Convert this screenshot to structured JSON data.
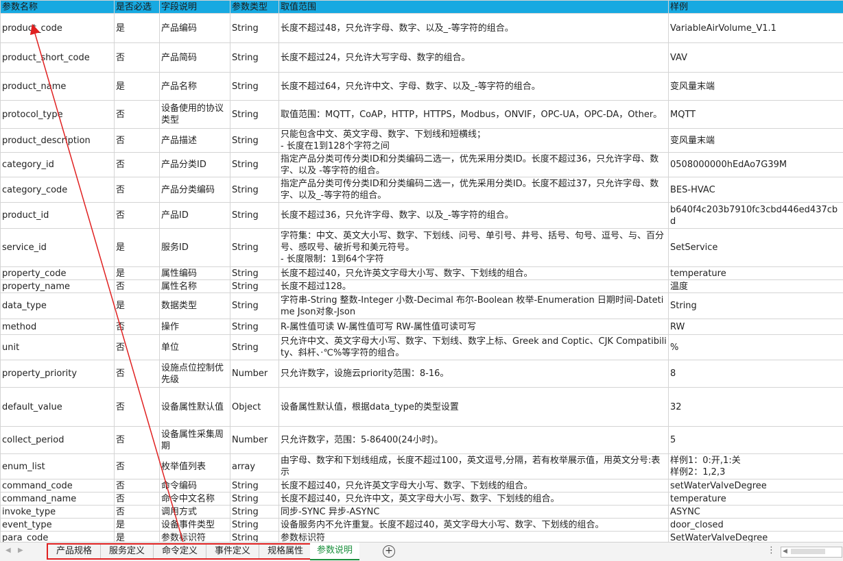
{
  "header": [
    "参数名称",
    "是否必选",
    "字段说明",
    "参数类型",
    "取值范围",
    "样例"
  ],
  "rows": [
    [
      "product_code",
      "是",
      "产品编码",
      "String",
      "长度不超过48，只允许字母、数字、以及_-等字符的组合。",
      "VariableAirVolume_V1.1"
    ],
    [
      "product_short_code",
      "否",
      "产品简码",
      "String",
      "长度不超过24，只允许大写字母、数字的组合。",
      "VAV"
    ],
    [
      "product_name",
      "是",
      "产品名称",
      "String",
      "长度不超过64，只允许中文、字母、数字、以及_-等字符的组合。",
      "变风量末端"
    ],
    [
      "protocol_type",
      "否",
      "设备使用的协议类型",
      "String",
      "取值范围：MQTT，CoAP，HTTP，HTTPS，Modbus，ONVIF，OPC-UA，OPC-DA，Other。",
      "MQTT"
    ],
    [
      "product_description",
      "否",
      "产品描述",
      "String",
      "只能包含中文、英文字母、数字、下划线和短横线；\n- 长度在1到128个字符之间",
      "变风量末端"
    ],
    [
      "category_id",
      "否",
      "产品分类ID",
      "String",
      "指定产品分类可传分类ID和分类编码二选一，优先采用分类ID。长度不超过36，只允许字母、数字、以及 -等字符的组合。",
      "0508000000hEdAo7G39M"
    ],
    [
      "category_code",
      "否",
      "产品分类编码",
      "String",
      "指定产品分类可传分类ID和分类编码二选一，优先采用分类ID。长度不超过37，只允许字母、数字、以及_-等字符的组合。",
      "BES-HVAC"
    ],
    [
      "product_id",
      "否",
      "产品ID",
      "String",
      "长度不超过36，只允许字母、数字、以及_-等字符的组合。",
      "b640f4c203b7910fc3cbd446ed437cbd"
    ],
    [
      "service_id",
      "是",
      "服务ID",
      "String",
      "字符集：中文、英文大小写、数字、下划线、问号、单引号、井号、括号、句号、逗号、与、百分号、感叹号、破折号和美元符号。\n- 长度限制：1到64个字符",
      "SetService"
    ],
    [
      "property_code",
      "是",
      "属性编码",
      "String",
      "长度不超过40，只允许英文字母大小写、数字、下划线的组合。",
      "temperature"
    ],
    [
      "property_name",
      "否",
      "属性名称",
      "String",
      "长度不超过128。",
      "温度"
    ],
    [
      "data_type",
      "是",
      "数据类型",
      "String",
      "字符串-String 整数-Integer 小数-Decimal 布尔-Boolean 枚举-Enumeration 日期时间-Datetime Json对象-Json",
      "String"
    ],
    [
      "method",
      "否",
      "操作",
      "String",
      "R-属性值可读  W-属性值可写 RW-属性值可读可写",
      "RW"
    ],
    [
      "unit",
      "否",
      "单位",
      "String",
      "只允许中文、英文字母大小写、数字、下划线、数字上标、Greek and Coptic、CJK Compatibility、斜杆、·℃%等字符的组合。",
      "%"
    ],
    [
      "property_priority",
      "否",
      "设施点位控制优先级",
      "Number",
      "只允许数字，设施云priority范围：8-16。",
      "8"
    ],
    [
      "default_value",
      "否",
      "设备属性默认值",
      "Object",
      "设备属性默认值，根据data_type的类型设置",
      "32"
    ],
    [
      "collect_period",
      "否",
      "设备属性采集周期",
      "Number",
      "只允许数字，范围：5-86400(24小时)。",
      "5"
    ],
    [
      "enum_list",
      "否",
      "枚举值列表",
      "array",
      "由字母、数字和下划线组成，长度不超过100，英文逗号,分隔，若有枚举展示值，用英文分号:表示",
      "样例1：0:开,1:关\n样例2：1,2,3"
    ],
    [
      "command_code",
      "否",
      "命令编码",
      "String",
      "长度不超过40，只允许英文字母大小写、数字、下划线的组合。",
      "setWaterValveDegree"
    ],
    [
      "command_name",
      "否",
      "命令中文名称",
      "String",
      "长度不超过40，只允许中文，英文字母大小写、数字、下划线的组合。",
      "temperature"
    ],
    [
      "invoke_type",
      "否",
      "调用方式",
      "String",
      "同步-SYNC 异步-ASYNC",
      "ASYNC"
    ],
    [
      "event_type",
      "是",
      "设备事件类型",
      "String",
      "设备服务内不允许重复。长度不超过40，英文字母大小写、数字、下划线的组合。",
      "door_closed"
    ],
    [
      "para_code",
      "是",
      "参数标识符",
      "String",
      "参数标识符",
      "SetWaterValveDegree"
    ]
  ],
  "sheet_tabs": [
    "产品规格",
    "服务定义",
    "命令定义",
    "事件定义",
    "规格属性"
  ],
  "active_tab": "参数说明",
  "icons": {
    "add_sheet": "plus-circle-icon",
    "more": "more-vertical-icon",
    "prev": "left-arrow-icon"
  },
  "colors": {
    "header_bg": "#17a9e1",
    "annotation": "#e02020",
    "active_tab": "#1a8f3c"
  }
}
